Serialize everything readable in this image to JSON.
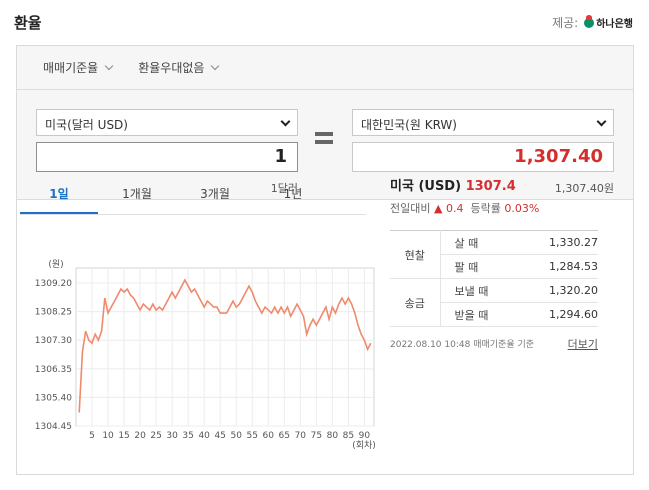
{
  "header": {
    "title": "환율",
    "provider_label": "제공:",
    "provider_name": "하나은행"
  },
  "filters": {
    "base_rate": "매매기준율",
    "preference": "환율우대없음"
  },
  "converter": {
    "from_currency": "미국(달러 USD)",
    "from_amount": "1",
    "from_text": "1달러",
    "to_currency": "대한민국(원 KRW)",
    "to_amount": "1,307.40",
    "to_text": "1,307.40원"
  },
  "chart_tabs": [
    "1일",
    "1개월",
    "3개월",
    "1년"
  ],
  "chart_data": {
    "type": "line",
    "ylabel": "(원)",
    "xlabel": "(회차)",
    "y_ticks": [
      "1309.20",
      "1308.25",
      "1307.30",
      "1306.35",
      "1305.40",
      "1304.45"
    ],
    "ylim": [
      1304.45,
      1309.7
    ],
    "x_ticks": [
      "5",
      "10",
      "15",
      "20",
      "25",
      "30",
      "35",
      "40",
      "45",
      "50",
      "55",
      "60",
      "65",
      "70",
      "75",
      "80",
      "85",
      "90"
    ],
    "xlim": [
      0,
      93
    ],
    "grid": true,
    "color": "#ef8a6c",
    "x": [
      1,
      2,
      3,
      4,
      5,
      6,
      7,
      8,
      9,
      10,
      11,
      12,
      13,
      14,
      15,
      16,
      17,
      18,
      19,
      20,
      21,
      22,
      23,
      24,
      25,
      26,
      27,
      28,
      29,
      30,
      31,
      32,
      33,
      34,
      35,
      36,
      37,
      38,
      39,
      40,
      41,
      42,
      43,
      44,
      45,
      46,
      47,
      48,
      49,
      50,
      51,
      52,
      53,
      54,
      55,
      56,
      57,
      58,
      59,
      60,
      61,
      62,
      63,
      64,
      65,
      66,
      67,
      68,
      69,
      70,
      71,
      72,
      73,
      74,
      75,
      76,
      77,
      78,
      79,
      80,
      81,
      82,
      83,
      84,
      85,
      86,
      87,
      88,
      89,
      90,
      91,
      92
    ],
    "values": [
      1304.9,
      1306.9,
      1307.6,
      1307.3,
      1307.2,
      1307.5,
      1307.3,
      1307.6,
      1308.7,
      1308.2,
      1308.4,
      1308.6,
      1308.8,
      1309.0,
      1308.9,
      1309.0,
      1308.8,
      1308.7,
      1308.5,
      1308.3,
      1308.5,
      1308.4,
      1308.3,
      1308.5,
      1308.3,
      1308.4,
      1308.3,
      1308.5,
      1308.7,
      1308.9,
      1308.7,
      1308.9,
      1309.1,
      1309.3,
      1309.1,
      1308.9,
      1309.0,
      1308.8,
      1308.6,
      1308.4,
      1308.6,
      1308.5,
      1308.4,
      1308.4,
      1308.2,
      1308.2,
      1308.2,
      1308.4,
      1308.6,
      1308.4,
      1308.5,
      1308.7,
      1308.9,
      1309.1,
      1308.9,
      1308.6,
      1308.4,
      1308.2,
      1308.4,
      1308.3,
      1308.2,
      1308.4,
      1308.2,
      1308.4,
      1308.2,
      1308.4,
      1308.1,
      1308.3,
      1308.5,
      1308.3,
      1308.1,
      1307.5,
      1307.8,
      1308.0,
      1307.8,
      1308.0,
      1308.2,
      1308.4,
      1308.0,
      1308.4,
      1308.2,
      1308.5,
      1308.7,
      1308.5,
      1308.7,
      1308.5,
      1308.2,
      1307.8,
      1307.5,
      1307.3,
      1307.0,
      1307.2
    ]
  },
  "info": {
    "currency": "미국 (USD)",
    "rate": "1307.4",
    "prev_label": "전일대비",
    "change_arrow": "▲",
    "change": "0.4",
    "pct_label": "등락률",
    "pct": "0.03%",
    "groups": [
      {
        "name": "현찰",
        "rows": [
          {
            "label": "살 때",
            "value": "1,330.27"
          },
          {
            "label": "팔 때",
            "value": "1,284.53"
          }
        ]
      },
      {
        "name": "송금",
        "rows": [
          {
            "label": "보낼 때",
            "value": "1,320.20"
          },
          {
            "label": "받을 때",
            "value": "1,294.60"
          }
        ]
      }
    ],
    "timestamp": "2022.08.10 10:48",
    "basis": "매매기준율 기준",
    "more": "더보기"
  }
}
